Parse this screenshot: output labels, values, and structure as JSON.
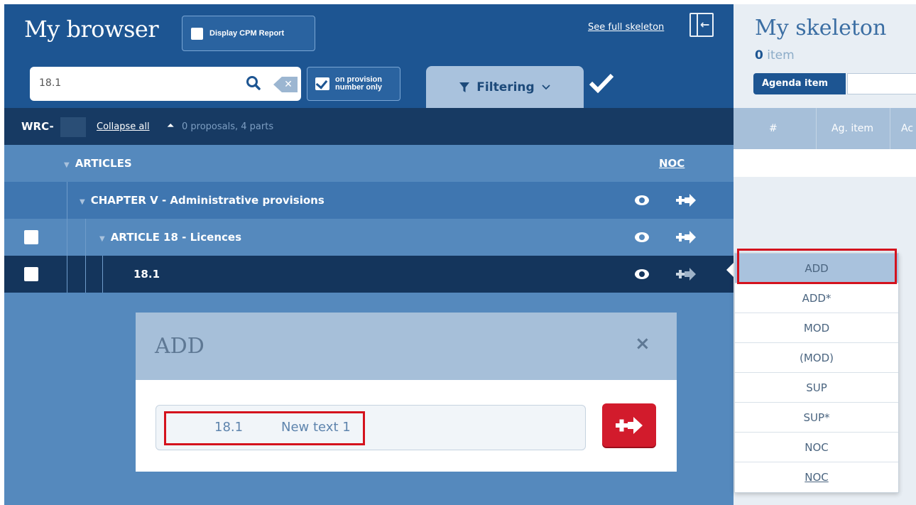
{
  "browser": {
    "title": "My browser",
    "cpm_button_label": "Display CPM Report",
    "full_skeleton_link": "See full skeleton",
    "search": {
      "value": "18.1"
    },
    "provision_toggle": {
      "label_line1": "on provision",
      "label_line2": "number only",
      "checked": true
    },
    "filter_tab_label": "Filtering"
  },
  "status": {
    "wrc_label": "WRC-",
    "collapse_link": "Collapse all",
    "summary": "0 proposals, 4 parts"
  },
  "tree": {
    "articles_label": "ARTICLES",
    "noc_link": "NOC",
    "chapter_label": "CHAPTER V - Administrative provisions",
    "article_label": "ARTICLE 18 - Licences",
    "provision_label": "18.1"
  },
  "add_dialog": {
    "title": "ADD",
    "close": "×",
    "entry_number": "18.1",
    "entry_text": "New text 1"
  },
  "skeleton": {
    "title": "My skeleton",
    "item_count": "0",
    "item_unit": "item",
    "agenda_label": "Agenda item",
    "columns": [
      "#",
      "Ag. item",
      "Ac"
    ]
  },
  "action_menu": {
    "items": [
      "ADD",
      "ADD*",
      "MOD",
      "(MOD)",
      "SUP",
      "SUP*",
      "NOC",
      "NOC"
    ]
  },
  "colors": {
    "primary_dark": "#1d5592",
    "panel_blue": "#5589bd",
    "highlight_red": "#d4121d",
    "add_button_red": "#d21b2c"
  },
  "icons": [
    "search-icon",
    "clear-icon",
    "filter-icon",
    "chevron-down-icon",
    "check-icon",
    "collapse-up-icon",
    "caret-down-icon",
    "eye-icon",
    "add-arrow-icon",
    "close-icon",
    "skeleton-panel-icon"
  ]
}
